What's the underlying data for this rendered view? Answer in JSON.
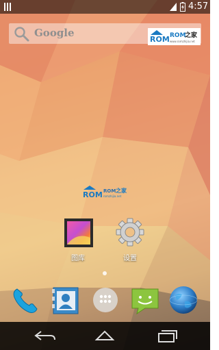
{
  "status_bar": {
    "time": "4:57"
  },
  "search": {
    "label": "Google"
  },
  "watermark": {
    "brand": "ROM",
    "suffix": "之家",
    "url": "www.romzhijia.net"
  },
  "center_logo": {
    "brand": "ROM",
    "cn": "之家",
    "sub": "romzhijia.net"
  },
  "apps": [
    {
      "label": "图库"
    },
    {
      "label": "设置"
    }
  ],
  "colors": {
    "accent_blue": "#1e88c8",
    "rom_blue": "#1a7ac2",
    "rom_orange": "#f08a1c"
  }
}
